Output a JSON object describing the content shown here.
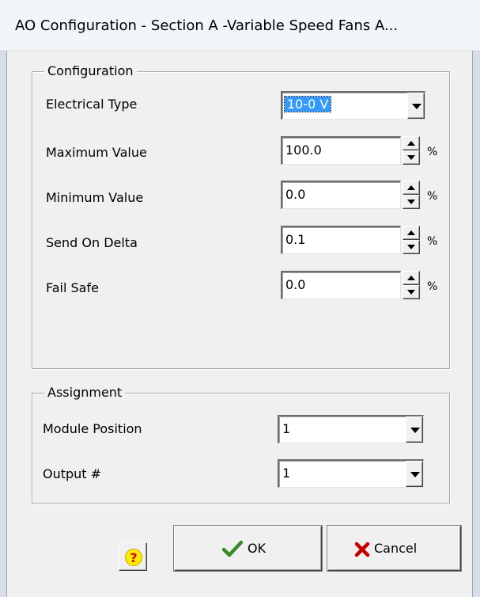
{
  "window": {
    "title": "AO Configuration - Section A -Variable Speed Fans A..."
  },
  "configuration": {
    "group_label": "Configuration",
    "electrical_type": {
      "label": "Electrical Type",
      "value": "10-0 V"
    },
    "maximum_value": {
      "label": "Maximum Value",
      "value": "100.0",
      "unit": "%"
    },
    "minimum_value": {
      "label": "Minimum Value",
      "value": "0.0",
      "unit": "%"
    },
    "send_on_delta": {
      "label": "Send On Delta",
      "value": "0.1",
      "unit": "%"
    },
    "fail_safe": {
      "label": "Fail Safe",
      "value": "0.0",
      "unit": "%"
    }
  },
  "assignment": {
    "group_label": "Assignment",
    "module_position": {
      "label": "Module Position",
      "value": "1"
    },
    "output": {
      "label": "Output #",
      "value": "1"
    }
  },
  "buttons": {
    "help_glyph": "?",
    "ok_label": "OK",
    "cancel_label": "Cancel"
  },
  "colors": {
    "selection": "#3399ff",
    "ok_check": "#3a8a2a",
    "cancel_x": "#c40000",
    "help_bg": "#ffec00"
  },
  "icons": {
    "ok": "checkmark-icon",
    "cancel": "x-icon",
    "help": "question-icon"
  }
}
